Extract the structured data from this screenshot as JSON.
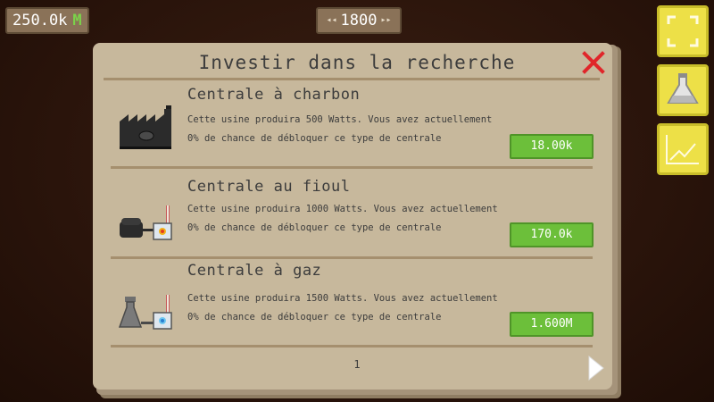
{
  "hud": {
    "money": "250.0k",
    "money_unit": "M",
    "year": "1800"
  },
  "side_buttons": [
    {
      "icon": "fullscreen-icon"
    },
    {
      "icon": "flask-icon"
    },
    {
      "icon": "chart-icon"
    }
  ],
  "dialog": {
    "title": "Investir dans la recherche",
    "page": "1",
    "items": [
      {
        "name": "Centrale à charbon",
        "desc1": "Cette usine produira 500 Watts. Vous avez actuellement",
        "desc2": "0% de chance de débloquer ce type de centrale",
        "price": "18.00k",
        "icon": "coal-plant-icon"
      },
      {
        "name": "Centrale au fioul",
        "desc1": "Cette usine produira 1000 Watts. Vous avez actuellement",
        "desc2": "0% de chance de débloquer ce type de centrale",
        "price": "170.0k",
        "icon": "oil-plant-icon"
      },
      {
        "name": "Centrale à gaz",
        "desc1": "Cette usine produira 1500 Watts. Vous avez actuellement",
        "desc2": "0% de chance de débloquer ce type de centrale",
        "price": "1.600M",
        "icon": "gas-plant-icon"
      }
    ]
  }
}
